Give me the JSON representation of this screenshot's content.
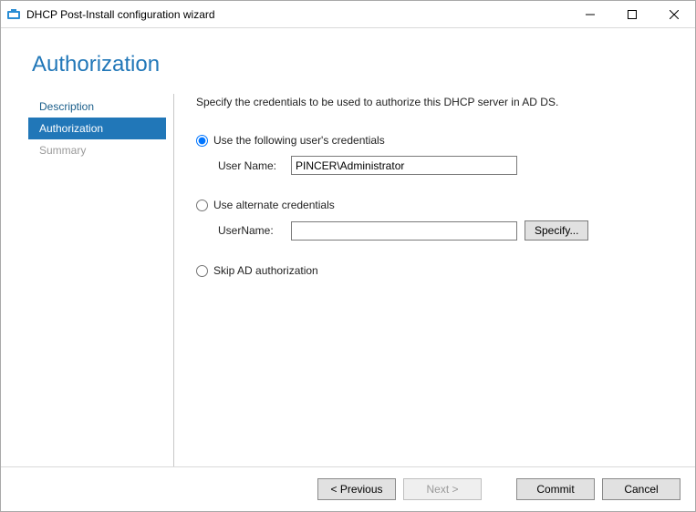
{
  "window": {
    "title": "DHCP Post-Install configuration wizard"
  },
  "page": {
    "title": "Authorization"
  },
  "sidebar": {
    "items": [
      {
        "label": "Description",
        "state": "normal"
      },
      {
        "label": "Authorization",
        "state": "active"
      },
      {
        "label": "Summary",
        "state": "inactive"
      }
    ]
  },
  "content": {
    "instruction": "Specify the credentials to be used to authorize this DHCP server in AD DS.",
    "opt1": {
      "label": "Use the following user's credentials",
      "field_label": "User Name:",
      "value": "PINCER\\Administrator"
    },
    "opt2": {
      "label": "Use alternate credentials",
      "field_label": "UserName:",
      "value": "",
      "specify_btn": "Specify..."
    },
    "opt3": {
      "label": "Skip AD authorization"
    }
  },
  "footer": {
    "previous": "< Previous",
    "next": "Next >",
    "commit": "Commit",
    "cancel": "Cancel"
  }
}
